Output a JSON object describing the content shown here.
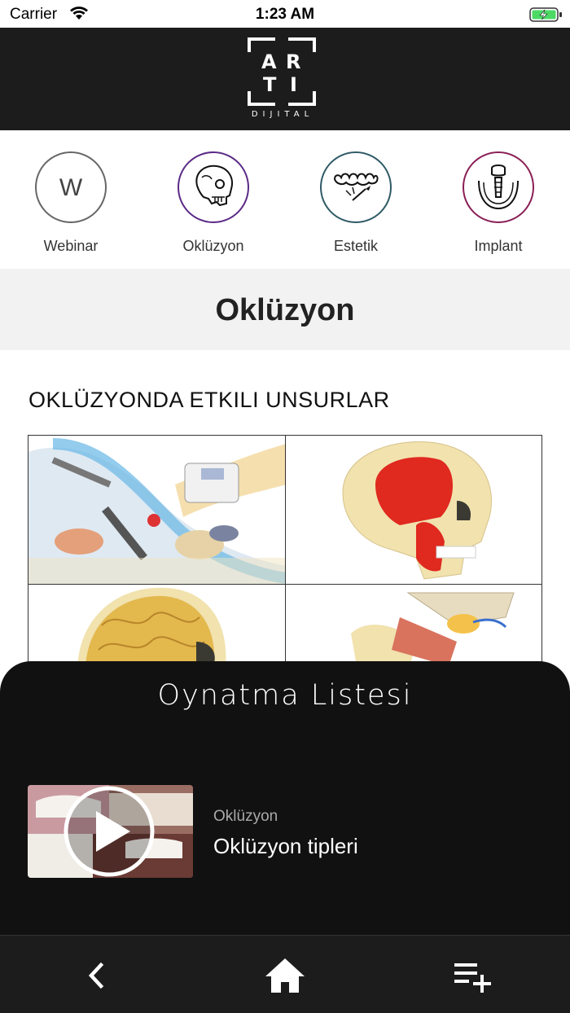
{
  "status_bar": {
    "carrier": "Carrier",
    "time": "1:23 AM",
    "icons": [
      "wifi-icon",
      "battery-charging-icon"
    ]
  },
  "header": {
    "logo_letters": [
      "A",
      "R",
      "T",
      "I"
    ],
    "logo_subtitle": "DIJITAL"
  },
  "categories": [
    {
      "label": "Webinar",
      "icon": "w-letter-icon",
      "letter": "W",
      "color": "#555555"
    },
    {
      "label": "Oklüzyon",
      "icon": "skull-icon",
      "color": "#5b2a86"
    },
    {
      "label": "Estetik",
      "icon": "teeth-icon",
      "color": "#2f5a66"
    },
    {
      "label": "Implant",
      "icon": "implant-icon",
      "color": "#8a1f55"
    }
  ],
  "page": {
    "title": "Oklüzyon",
    "section_heading": "OKLÜZYONDA ETKILI UNSURLAR"
  },
  "image_grid": [
    {
      "name": "dental-tools-image"
    },
    {
      "name": "skull-muscle-image"
    },
    {
      "name": "brain-image"
    },
    {
      "name": "jaw-joint-image"
    }
  ],
  "playlist": {
    "title": "Oynatma Listesi",
    "items": [
      {
        "category": "Oklüzyon",
        "title": "Oklüzyon tipleri"
      }
    ]
  },
  "bottom_nav": {
    "items": [
      {
        "icon": "back-icon"
      },
      {
        "icon": "home-icon"
      },
      {
        "icon": "playlist-add-icon"
      }
    ]
  },
  "colors": {
    "header_bg": "#1c1c1c",
    "sheet_bg": "#111111",
    "title_band_bg": "#f2f2f2"
  }
}
